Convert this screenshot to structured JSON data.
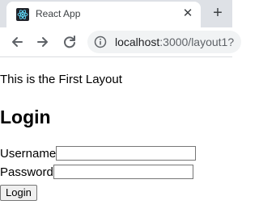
{
  "browser": {
    "tab": {
      "title": "React App",
      "favicon": "react-logo-icon",
      "close_icon": "close-icon",
      "close_glyph": "✕"
    },
    "new_tab_icon": "plus-icon",
    "new_tab_glyph": "+",
    "toolbar": {
      "back_icon": "arrow-left-icon",
      "forward_icon": "arrow-right-icon",
      "reload_icon": "reload-icon",
      "info_icon": "info-icon",
      "url_host": "localhost",
      "url_path": ":3000/layout1?"
    }
  },
  "page": {
    "intro_text": "This is the First Layout",
    "heading": "Login",
    "username_label": "Username",
    "username_value": "",
    "password_label": "Password",
    "password_value": "",
    "login_button": "Login"
  },
  "colors": {
    "tabstrip": "#dee1e6",
    "omnibox": "#f1f3f4",
    "react_bg": "#20232a",
    "react_logo": "#61dafb"
  }
}
